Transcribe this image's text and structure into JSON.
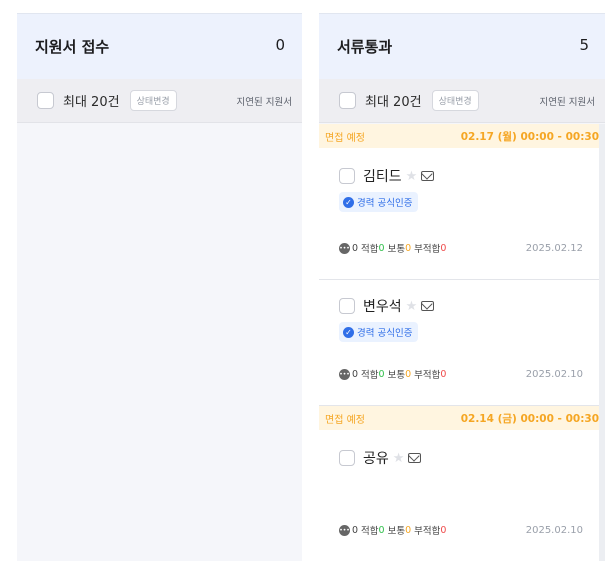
{
  "columns": [
    {
      "title": "지원서 접수",
      "count": "0",
      "toolbar": {
        "max_label": "최대 20건",
        "status_button": "상태변경",
        "delayed_label": "지연된 지원서"
      }
    },
    {
      "title": "서류통과",
      "count": "5",
      "toolbar": {
        "max_label": "최대 20건",
        "status_button": "상태변경",
        "delayed_label": "지연된 지원서"
      },
      "cards": [
        {
          "banner": {
            "label": "면접 예정",
            "time": "02.17 (월) 00:00 - 00:30"
          },
          "name": "김티드",
          "badge": "경력 공식인증",
          "stats": {
            "count": "0",
            "fit_label": "적합",
            "fit": "0",
            "normal_label": "보통",
            "normal": "0",
            "unfit_label": "부적합",
            "unfit": "0"
          },
          "date": "2025.02.12"
        },
        {
          "name": "변우석",
          "badge": "경력 공식인증",
          "stats": {
            "count": "0",
            "fit_label": "적합",
            "fit": "0",
            "normal_label": "보통",
            "normal": "0",
            "unfit_label": "부적합",
            "unfit": "0"
          },
          "date": "2025.02.10"
        },
        {
          "banner": {
            "label": "면접 예정",
            "time": "02.14 (금) 00:00 - 00:30"
          },
          "name": "공유",
          "stats": {
            "count": "0",
            "fit_label": "적합",
            "fit": "0",
            "normal_label": "보통",
            "normal": "0",
            "unfit_label": "부적합",
            "unfit": "0"
          },
          "date": "2025.02.10"
        }
      ]
    }
  ],
  "colors": {
    "banner_text": "#f5a623",
    "badge_blue": "#2f6ee8",
    "fit_green": "#2fbf4a",
    "unfit_red": "#ef4b4b"
  }
}
